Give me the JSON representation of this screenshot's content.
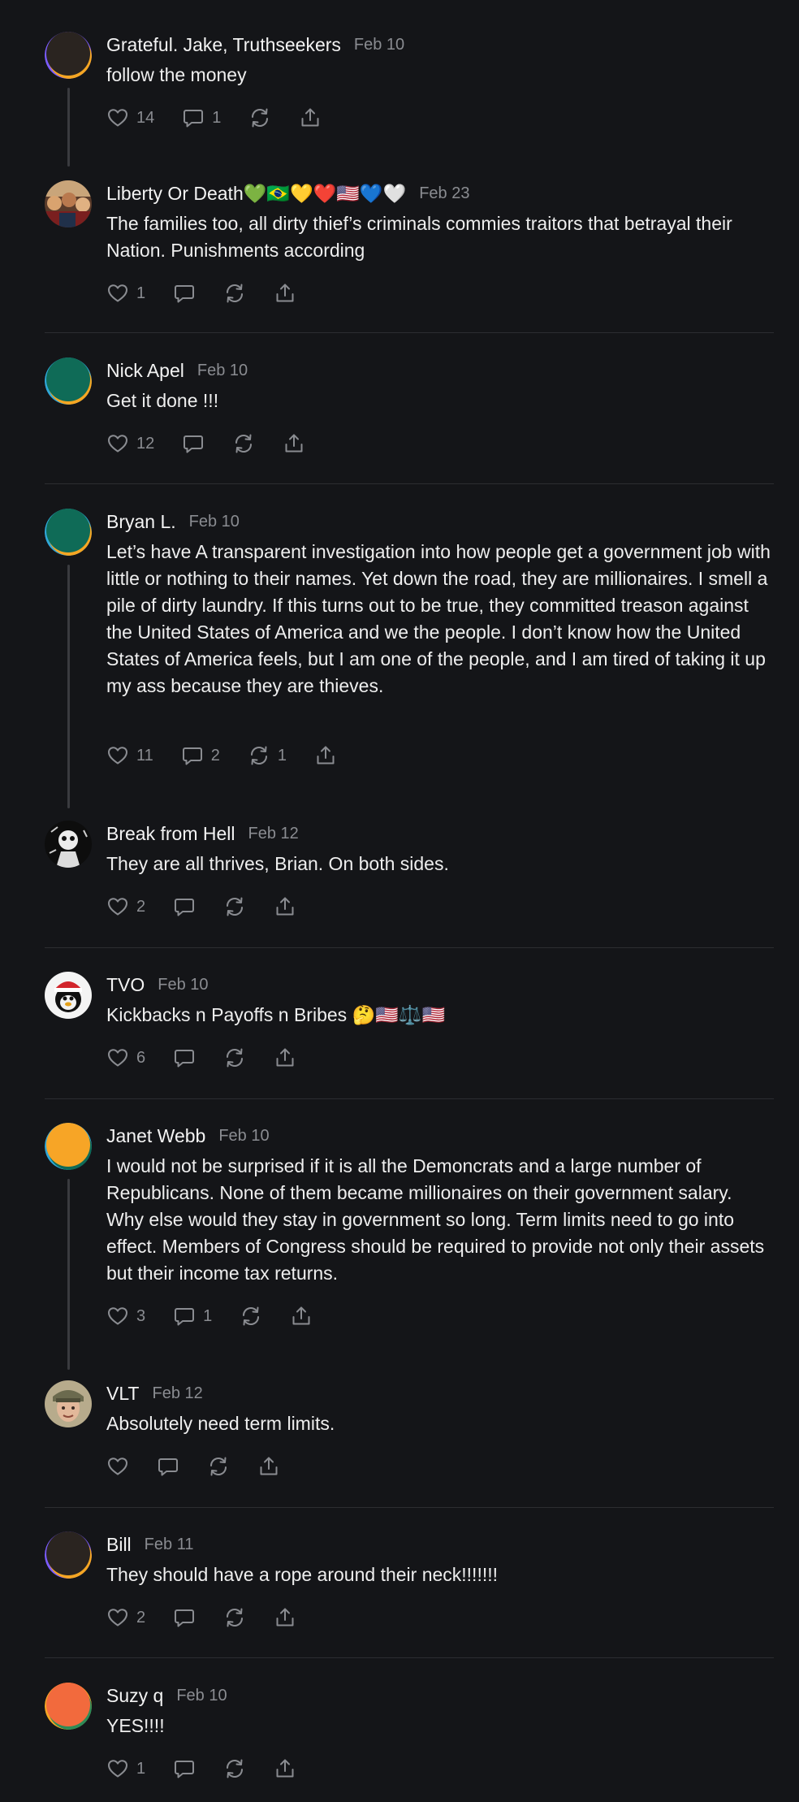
{
  "colors": {
    "background": "#141518",
    "text": "#f2f2f2",
    "muted": "#8a8c91",
    "divider": "#2c2d31",
    "thread_line": "#3a3b3f"
  },
  "icons": {
    "like": "heart-icon",
    "reply": "comment-icon",
    "repost": "repost-icon",
    "share": "share-icon",
    "more": "more-icon"
  },
  "posts": [
    {
      "name": "Grateful. Jake, Truthseekers",
      "date": "Feb 10",
      "body": "follow the money",
      "likes": "14",
      "replies": "1",
      "reposts": "",
      "avatar": "dark-ring"
    },
    {
      "name": "Liberty Or Death💚🇧🇷💛❤️🇺🇸💙🤍",
      "date": "Feb 23",
      "body": "The families too, all dirty thief’s criminals commies traitors that betrayal their Nation. Punishments according",
      "likes": "1",
      "replies": "",
      "reposts": "",
      "avatar": "photo-crowd"
    },
    {
      "name": "Nick Apel",
      "date": "Feb 10",
      "body": "Get it done !!!",
      "likes": "12",
      "replies": "",
      "reposts": "",
      "avatar": "green-ring"
    },
    {
      "name": "Bryan L.",
      "date": "Feb 10",
      "body": "Let’s have A transparent investigation into how people get a government job with little or nothing to their names. Yet down the road, they are millionaires. I smell a pile of dirty laundry. If this turns out to be true, they committed treason against the United States of America and we the people. I don’t know how the United States of America feels, but I am one of the people, and I am tired of taking it up my ass because they are thieves.",
      "likes": "11",
      "replies": "2",
      "reposts": "1",
      "avatar": "green-ring"
    },
    {
      "name": "Break from Hell",
      "date": "Feb 12",
      "body": "They are all thrives, Brian. On both sides.",
      "likes": "2",
      "replies": "",
      "reposts": "",
      "avatar": "photo-sketch"
    },
    {
      "name": "TVO",
      "date": "Feb 10",
      "body": "Kickbacks n Payoffs n Bribes 🤔🇺🇸⚖️🇺🇸",
      "likes": "6",
      "replies": "",
      "reposts": "",
      "avatar": "photo-cartoon"
    },
    {
      "name": "Janet Webb",
      "date": "Feb 10",
      "body": "I would not be surprised if it is all the Demoncrats and a large number of Republicans. None of them became millionaires on their government salary. Why else would they stay in government so long. Term limits need to go into effect. Members of Congress should be required to provide not only their assets but their income tax returns.",
      "likes": "3",
      "replies": "1",
      "reposts": "",
      "avatar": "orange-ring"
    },
    {
      "name": "VLT",
      "date": "Feb 12",
      "body": "Absolutely need term limits.",
      "likes": "",
      "replies": "",
      "reposts": "",
      "avatar": "photo-person"
    },
    {
      "name": "Bill",
      "date": "Feb 11",
      "body": "They should have a rope around their neck!!!!!!!",
      "likes": "2",
      "replies": "",
      "reposts": "",
      "avatar": "dark-ring"
    },
    {
      "name": "Suzy q",
      "date": "Feb 10",
      "body": "YES!!!!",
      "likes": "1",
      "replies": "",
      "reposts": "",
      "avatar": "coral-ring"
    }
  ]
}
